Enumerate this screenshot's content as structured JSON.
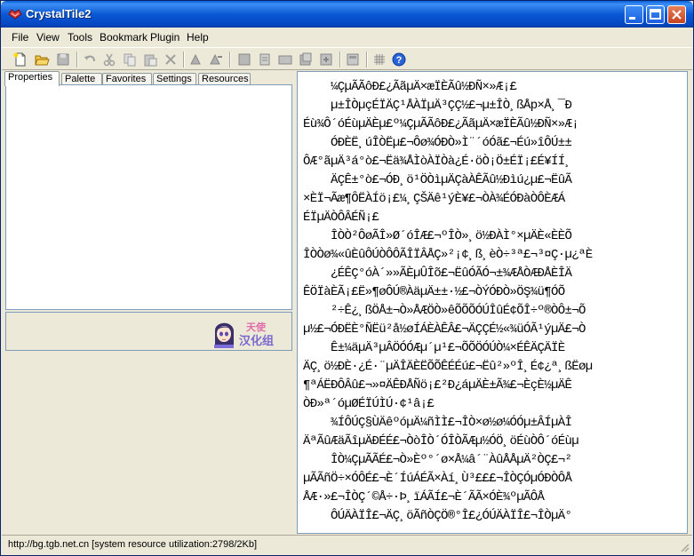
{
  "window": {
    "title": "CrystalTile2"
  },
  "menu": [
    "File",
    "View",
    "Tools",
    "Bookmark",
    "Plugin",
    "Help"
  ],
  "toolbar": {
    "icons": [
      "new-file-icon",
      "open-folder-icon",
      "save-icon",
      "undo-icon",
      "cut-icon",
      "copy-icon",
      "paste-icon",
      "delete-icon",
      "find-icon",
      "replace-icon",
      "tile-view-icon",
      "page-icon",
      "palette-icon",
      "bookmark-icon",
      "import-icon",
      "export-icon",
      "grid-icon",
      "help-icon"
    ]
  },
  "tabs": [
    "Properties",
    "Palette",
    "Favorites",
    "Settings",
    "Resources"
  ],
  "logo_text": "天使汉化组",
  "text_lines": [
    "    ¼ÇµÃÃôÐ£¿ÃãµÄ×æÏÈÃû½ÐÑ×»Æ¡£",
    "    µ±ÎÒµçÉÏÄÇ¹ÅÀÏµÄ³ÇÇ½£¬µ±ÎÒ¸ßÅp×Å¸¯Ð",
    "Éù¾Ô´óÉùµÄÈµ£º¼ÇµÃÃôÐ£¿ÃãµÄ×æÏÈÃû½ÐÑ×»Æ¡",
    "    ÓÐÈË¸úÎÒËµ£¬Ôø¾­ÓÐÒ»Ì¨´óÓã£¬Éú»îÔÚ±±",
    "ÔÆ°ãµÄ³á°ò£¬Ëä¾ÅÌòÀÏÒà¿É·öÒ¡Ö±ÉÏ¡£É¥ÍÍ¸",
    "    ÄÇÊ±°ò£¬ÓÐ¸ö¹ÖÒìµÄÇàÀÊÃû½Ðìú¿µ£¬ËûÃ",
    "×ÈÏ¬Ãæ¶ÔËÀÍö¡£¼¸ÇŠÄê¹ýÈ¥£¬ÒÀ¾ÉÓÐàÒÔÈÆÁ",
    "ÉÏµÄÒÔÂÉÑ¡£",
    "    ÎÒÒ²ÔøÃÎ»Ø´óÎÆ£¬º­ÎÒ»¸ö½ÐÀÌ°×µÄÈ«ÈÈÕ",
    "ÎÒÒø¾«ûÈûÔÚÒÔÔÃÎÏÂÅÇ»²¡¢¸ß¸èÒ÷³ª£¬³¤Ç·µ¿ªÈ",
    "    ¿ÉÊÇ°óÀ´»»ÃÈµÛÎõ£¬ËûÓÃÓ¬±¾ÆÅÒÆÐÅÈÎÄ",
    "ÊÖÏàÈÃ¡£Ë»¶øÔÚ®ÀäµÄ±±·½£¬ÒÝÓÐÒ»ÖŞ¾ü¶ÓÕ",
    "    ²÷Ê¿¸ßÖÅ±¬Ò»ÅÆÖÒ»êÕÕÕÓÚÎûÉ¢ÕÎ÷º®ÒÔ±¬Õ",
    "µ½£¬ÓÐËÈ°ÑËü²å½øÍÁÈÀÊÂ£¬ÄÇÇÉ½«¾üÓÃ¹ýµÄ£¬Ò",
    "    Ê±¼äµÄ³µÂÖÓÓÆµ´µ¹£¬ÕÕÖÓÚÒ¼×ÉÊÄÇÄÏÈ",
    "ÄÇ¸ö½ÐÈ·¿É·¨µÄÎÄÈËÕÕÊÉÉú£¬Ëû²»ºÎ¸É¢¿ª¸ßËøµ",
    "¶ªÁËÐÔÂû£¬»¤ÄÊÐÅÑö¡£²Ð¿áµÄÈ±Ã¾£¬ÈçÈ½µÄÊ",
    "ÒÐ»ª´óµØÉÏÚÌÚ·¢¹â¡£",
    "    ¾ÍÔÚÇ§ÙÄêºóµÄ¼ñÌÌ£¬ÎÒ×ø½ø¼ÓÓµ±ÂÍµÀÎ",
    "ÄªÃûÆäÃîµÄÐÉÉ£¬ÒòÎÒ´ÓÎÒÃÆµ½ÓÖ¸öÉùÒÔ´óÉùµ",
    "    ÎÒ¼ÇµÃÃÉ£¬Ò»Èº°´ø×Å¼â´¨ÀûÅÅµÄ²ÒÇ£¬²",
    "µÃÃñÖ÷×ÓÔÉ£¬È´ÍúÁÉÃ×Àí¸Ù³£££¬ÎÒÇÓµÓÐÒÔÅ",
    "ÅÆ·»£¬ÎÒÇ´©Å÷·Þ¸ïÁÃÍ£¬È´ÃÃ×ÓÈ¾ºµÃÔÅ",
    "    ÔÚÄÀÏÎ£¬ÄÇ¸öÃñÒÇÖ®°Î£¿ÓÚÄÀÏÎ£¬ÎÒµÄ°"
  ],
  "status": {
    "text": "http://bg.tgb.net.cn [system resource utilization:2798/2Kb]"
  }
}
